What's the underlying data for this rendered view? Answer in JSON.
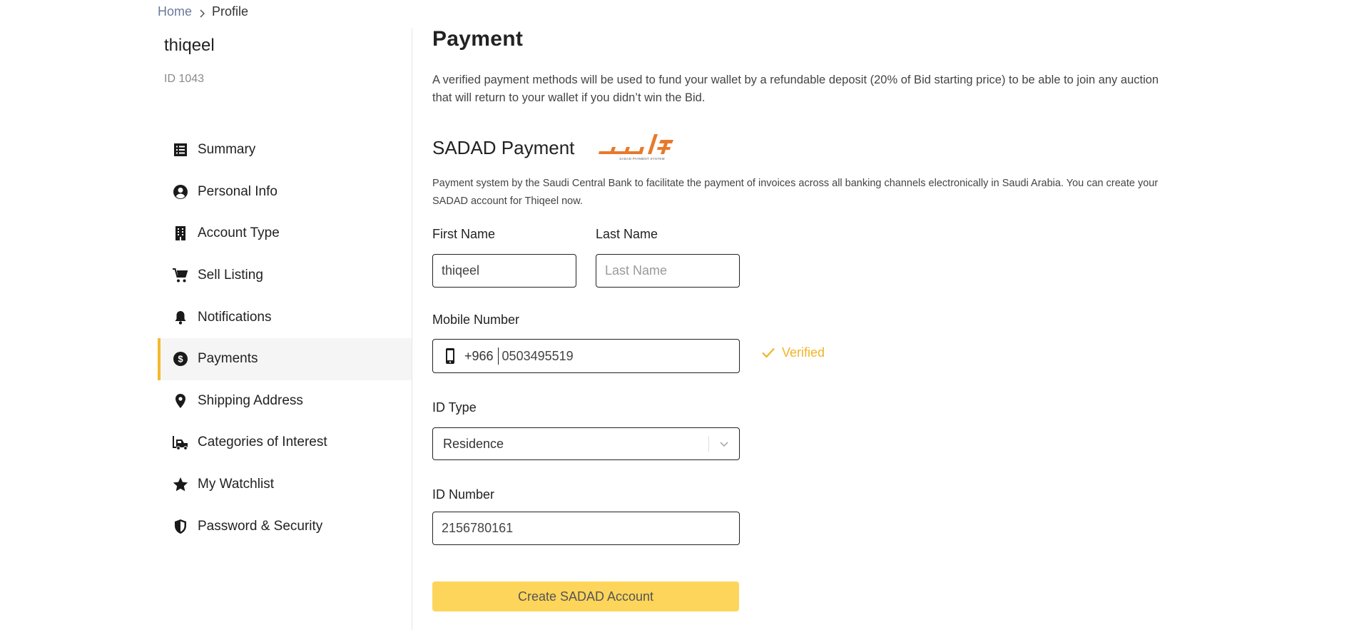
{
  "breadcrumb": {
    "home": "Home",
    "current": "Profile"
  },
  "user": {
    "name": "thiqeel",
    "id_text": "ID 1043"
  },
  "sidebar": {
    "items": [
      {
        "label": "Summary",
        "icon": "list-icon"
      },
      {
        "label": "Personal Info",
        "icon": "user-circle-icon"
      },
      {
        "label": "Account Type",
        "icon": "building-icon"
      },
      {
        "label": "Sell Listing",
        "icon": "cart-icon"
      },
      {
        "label": "Notifications",
        "icon": "bell-icon"
      },
      {
        "label": "Payments",
        "icon": "dollar-circle-icon",
        "active": true
      },
      {
        "label": "Shipping Address",
        "icon": "map-pin-icon"
      },
      {
        "label": "Categories of Interest",
        "icon": "forklift-icon"
      },
      {
        "label": "My Watchlist",
        "icon": "star-icon"
      },
      {
        "label": "Password & Security",
        "icon": "shield-icon"
      }
    ]
  },
  "main": {
    "title": "Payment",
    "intro": "A verified payment methods will be used to fund your wallet by a refundable deposit (20% of Bid starting price) to be able to join any auction that will return to your wallet if you didn’t win the Bid.",
    "sadad_title": "SADAD Payment",
    "sadad_logo_text": "SADAD PAYMENT SYSTEM",
    "sadad_desc": "Payment system by the Saudi Central Bank to facilitate the payment of invoices across all banking channels electronically in Saudi Arabia. You can create your SADAD account for Thiqeel now.",
    "form": {
      "first_name_label": "First Name",
      "first_name_value": "thiqeel",
      "last_name_label": "Last Name",
      "last_name_placeholder": "Last Name",
      "mobile_label": "Mobile Number",
      "mobile_code": "+966",
      "mobile_number": "0503495519",
      "verified_text": "Verified",
      "id_type_label": "ID Type",
      "id_type_value": "Residence",
      "id_number_label": "ID Number",
      "id_number_value": "2156780161",
      "submit_label": "Create SADAD Account"
    }
  },
  "colors": {
    "accent": "#f4b92d",
    "button": "#fdd55b",
    "sadad_orange": "#e8792b"
  }
}
